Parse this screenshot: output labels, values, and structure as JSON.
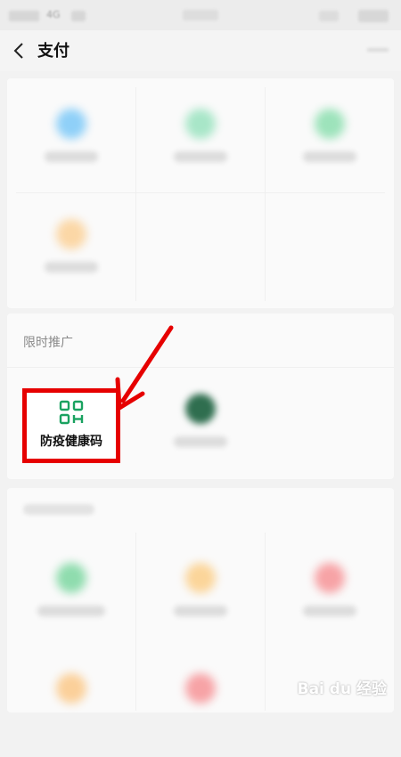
{
  "statusbar": {
    "network": "4G"
  },
  "navbar": {
    "title": "支付"
  },
  "promo": {
    "section_title": "限时推广",
    "health_code_label": "防疫健康码"
  },
  "colors": {
    "highlight_border": "#e60000",
    "arrow": "#e60000",
    "qr_icon": "#1aa260"
  },
  "watermark": {
    "text": "Bai du 经验"
  }
}
